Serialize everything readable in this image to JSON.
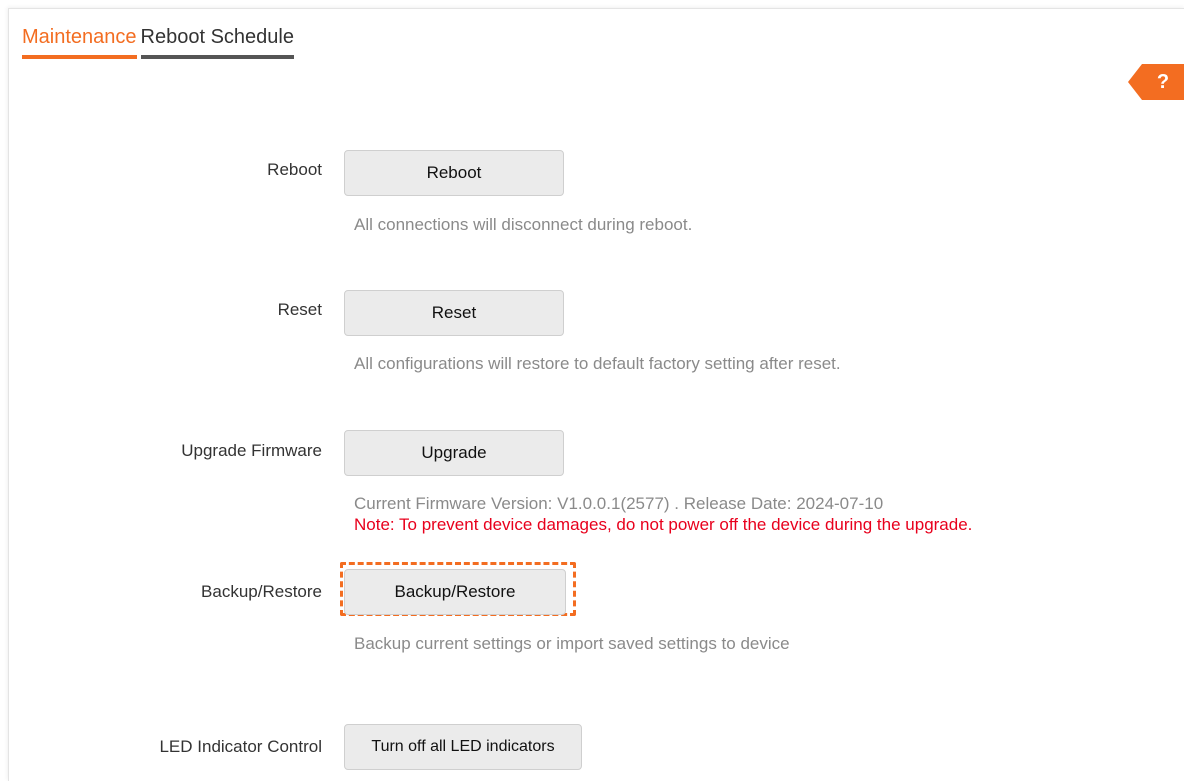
{
  "tabs": [
    {
      "label": "Maintenance",
      "active": true
    },
    {
      "label": "Reboot Schedule",
      "active": false
    }
  ],
  "help": {
    "label": "?"
  },
  "rows": {
    "reboot": {
      "label": "Reboot",
      "button": "Reboot",
      "hint": "All connections will disconnect during reboot."
    },
    "reset": {
      "label": "Reset",
      "button": "Reset",
      "hint": "All configurations will restore to default factory setting after reset."
    },
    "upgrade": {
      "label": "Upgrade Firmware",
      "button": "Upgrade",
      "hint": "Current Firmware Version: V1.0.0.1(2577) . Release Date: 2024-07-10",
      "note": "Note: To prevent device damages, do not power off the device during the upgrade."
    },
    "backup": {
      "label": "Backup/Restore",
      "button": "Backup/Restore",
      "hint": "Backup current settings or import saved settings to device"
    },
    "led": {
      "label": "LED Indicator Control",
      "button": "Turn off all LED indicators"
    }
  },
  "colors": {
    "accent": "#f36d21",
    "warning": "#e8001c",
    "hint": "#8a8a8a"
  }
}
